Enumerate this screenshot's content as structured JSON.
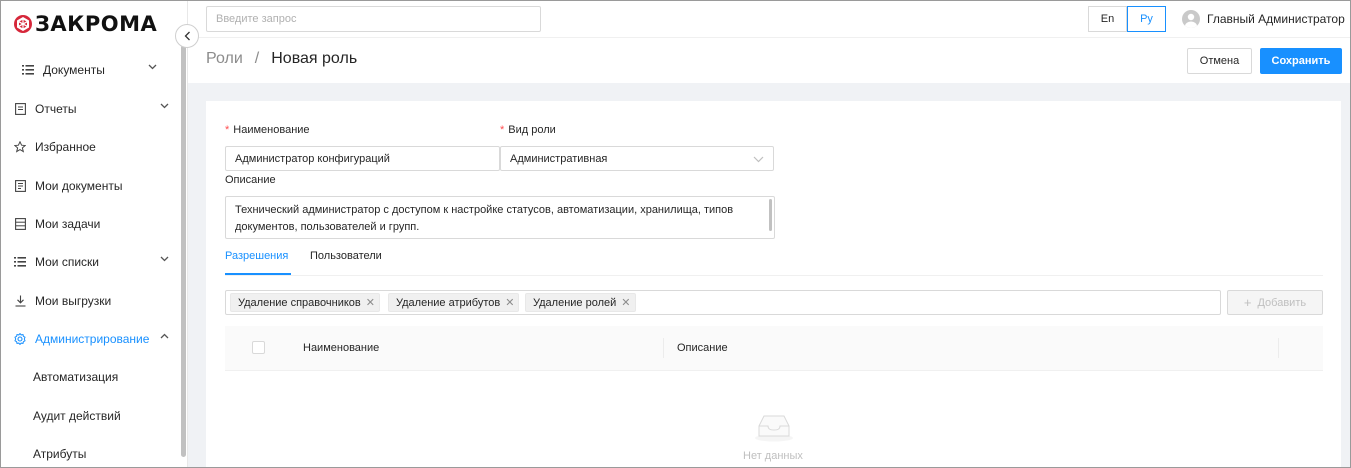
{
  "app": {
    "logo_text": "ЗАКРОМА"
  },
  "search": {
    "placeholder": "Введите запрос"
  },
  "languages": {
    "en": "En",
    "ru": "Ру"
  },
  "user": {
    "name": "Главный Администратор"
  },
  "sidebar": {
    "items": [
      {
        "label": "Документы",
        "icon": "list-icon",
        "expandable": true
      },
      {
        "label": "Отчеты",
        "icon": "report-icon",
        "expandable": true
      },
      {
        "label": "Избранное",
        "icon": "star-icon",
        "expandable": false
      },
      {
        "label": "Мои документы",
        "icon": "document-icon",
        "expandable": false
      },
      {
        "label": "Мои задачи",
        "icon": "tasks-icon",
        "expandable": false
      },
      {
        "label": "Мои списки",
        "icon": "list-icon",
        "expandable": true
      },
      {
        "label": "Мои выгрузки",
        "icon": "download-icon",
        "expandable": false
      },
      {
        "label": "Администрирование",
        "icon": "settings-icon",
        "expandable": true,
        "active": true
      }
    ],
    "subitems": [
      {
        "label": "Автоматизация"
      },
      {
        "label": "Аудит действий"
      },
      {
        "label": "Атрибуты"
      }
    ]
  },
  "breadcrumb": {
    "parent": "Роли",
    "separator": "/",
    "current": "Новая роль"
  },
  "actions": {
    "cancel": "Отмена",
    "save": "Сохранить"
  },
  "form": {
    "name_label": "Наименование",
    "name_value": "Администратор конфигураций",
    "role_type_label": "Вид роли",
    "role_type_value": "Административная",
    "description_label": "Описание",
    "description_value": "Технический администратор с доступом к настройке статусов, автоматизации, хранилища, типов документов, пользователей и групп.",
    "required_mark": "*"
  },
  "tabs": [
    {
      "label": "Разрешения",
      "active": true
    },
    {
      "label": "Пользователи",
      "active": false
    }
  ],
  "permissions": {
    "tags": [
      "Удаление справочников",
      "Удаление атрибутов",
      "Удаление ролей"
    ],
    "add_label": "Добавить"
  },
  "table": {
    "columns": [
      "Наименование",
      "Описание"
    ],
    "empty_text": "Нет данных"
  },
  "colors": {
    "accent": "#1890ff",
    "required": "#ff4d4f",
    "content_bg": "#f0f2f5"
  }
}
